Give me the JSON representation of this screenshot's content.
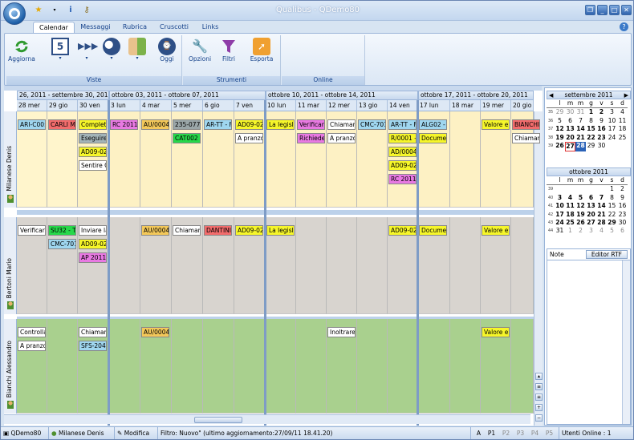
{
  "window": {
    "title": "Qualibus  -  QDemo80"
  },
  "tabs": [
    {
      "label": "Calendar"
    },
    {
      "label": "Messaggi"
    },
    {
      "label": "Rubrica"
    },
    {
      "label": "Cruscotti"
    },
    {
      "label": "Links"
    }
  ],
  "ribbon": {
    "groups": [
      {
        "label": "Viste"
      },
      {
        "label": "Strumenti"
      },
      {
        "label": "Online"
      }
    ],
    "buttons": {
      "aggiorna": "Aggiorna",
      "oggi": "Oggi",
      "opzioni": "Opzioni",
      "filtri": "Filtri",
      "esporta": "Esporta",
      "day_number": "5"
    }
  },
  "calendar": {
    "weeks": [
      {
        "label": "26, 2011 - settembre 30, 2011"
      },
      {
        "label": "ottobre 03, 2011 - ottobre 07, 2011"
      },
      {
        "label": "ottobre 10, 2011 - ottobre 14, 2011"
      },
      {
        "label": "ottobre 17, 2011 - ottobre 20, 2011"
      }
    ],
    "days": [
      "28 mer",
      "29 gio",
      "30 ven",
      "3 lun",
      "4 mar",
      "5 mer",
      "6 gio",
      "7 ven",
      "10 lun",
      "11 mar",
      "12 mer",
      "13 gio",
      "14 ven",
      "17 lun",
      "18 mar",
      "19 mer",
      "20 gio"
    ],
    "resources": [
      {
        "name": "Milanese Denis",
        "color": "#fdf1c4"
      },
      {
        "name": "Bertoni Mario",
        "color": "#d8d4cf"
      },
      {
        "name": "Bianchi Alessandro",
        "color": "#a9d08e"
      }
    ],
    "events": [
      {
        "res": 0,
        "day": 0,
        "row": 0,
        "text": "ARI-C00:",
        "color": "#9fd6ef"
      },
      {
        "res": 0,
        "day": 1,
        "row": 0,
        "text": "CARLI MA",
        "color": "#f26c6c"
      },
      {
        "res": 0,
        "day": 2,
        "row": 0,
        "text": "Completa",
        "color": "#f6f62a"
      },
      {
        "res": 0,
        "day": 2,
        "row": 1,
        "text": "Eseguire",
        "color": "#a3b4b8"
      },
      {
        "res": 0,
        "day": 2,
        "row": 2,
        "text": "AD09-02",
        "color": "#f6f62a"
      },
      {
        "res": 0,
        "day": 2,
        "row": 3,
        "text": "Sentire C",
        "color": "#ffffff"
      },
      {
        "res": 0,
        "day": 3,
        "row": 0,
        "text": "RC 2011",
        "color": "#e879e2"
      },
      {
        "res": 0,
        "day": 4,
        "row": 0,
        "text": "AU/0004",
        "color": "#f3c85a"
      },
      {
        "res": 0,
        "day": 5,
        "row": 0,
        "text": "235-0770",
        "color": "#9aa6a8"
      },
      {
        "res": 0,
        "day": 5,
        "row": 1,
        "text": "CAT002 -",
        "color": "#27d84a"
      },
      {
        "res": 0,
        "day": 6,
        "row": 0,
        "text": "AR-TT - F",
        "color": "#9fd6ef"
      },
      {
        "res": 0,
        "day": 7,
        "row": 0,
        "text": "AD09-02",
        "color": "#f6f62a"
      },
      {
        "res": 0,
        "day": 7,
        "row": 1,
        "text": "A pranzo",
        "color": "#ffffff"
      },
      {
        "res": 0,
        "day": 8,
        "row": 0,
        "text": "La legisla",
        "color": "#f6f62a"
      },
      {
        "res": 0,
        "day": 9,
        "row": 0,
        "text": "Verificare",
        "color": "#e879e2"
      },
      {
        "res": 0,
        "day": 9,
        "row": 1,
        "text": "Richieder",
        "color": "#e879e2"
      },
      {
        "res": 0,
        "day": 10,
        "row": 0,
        "text": "Chiamare",
        "color": "#ffffff"
      },
      {
        "res": 0,
        "day": 10,
        "row": 1,
        "text": "A pranzo",
        "color": "#ffffff"
      },
      {
        "res": 0,
        "day": 11,
        "row": 0,
        "text": "CMC-701",
        "color": "#9fd6ef"
      },
      {
        "res": 0,
        "day": 12,
        "row": 0,
        "text": "AR-TT - F",
        "color": "#9fd6ef"
      },
      {
        "res": 0,
        "day": 12,
        "row": 1,
        "text": "R/0001 -",
        "color": "#f6f62a"
      },
      {
        "res": 0,
        "day": 12,
        "row": 2,
        "text": "AD/0004",
        "color": "#f6f62a"
      },
      {
        "res": 0,
        "day": 12,
        "row": 3,
        "text": "AD09-02",
        "color": "#f6f62a"
      },
      {
        "res": 0,
        "day": 12,
        "row": 4,
        "text": "RC 2011",
        "color": "#e879e2"
      },
      {
        "res": 0,
        "day": 13,
        "row": 0,
        "text": "ALG02 - I",
        "color": "#9fd6ef"
      },
      {
        "res": 0,
        "day": 13,
        "row": 1,
        "text": "Documer",
        "color": "#f6f62a"
      },
      {
        "res": 0,
        "day": 15,
        "row": 0,
        "text": "Valore e",
        "color": "#f6f62a"
      },
      {
        "res": 0,
        "day": 16,
        "row": 0,
        "text": "BIANCHI",
        "color": "#f26c6c"
      },
      {
        "res": 0,
        "day": 16,
        "row": 1,
        "text": "Chiamar",
        "color": "#ffffff"
      },
      {
        "res": 1,
        "day": 0,
        "row": 0,
        "text": "Verificare",
        "color": "#ffffff"
      },
      {
        "res": 1,
        "day": 1,
        "row": 0,
        "text": "SU32 - T",
        "color": "#27d84a"
      },
      {
        "res": 1,
        "day": 1,
        "row": 1,
        "text": "CMC-701",
        "color": "#9fd6ef"
      },
      {
        "res": 1,
        "day": 2,
        "row": 0,
        "text": "Inviare la",
        "color": "#ffffff"
      },
      {
        "res": 1,
        "day": 2,
        "row": 1,
        "text": "AD09-02",
        "color": "#f6f62a"
      },
      {
        "res": 1,
        "day": 2,
        "row": 2,
        "text": "AP 2011",
        "color": "#e879e2"
      },
      {
        "res": 1,
        "day": 4,
        "row": 0,
        "text": "AU/0004",
        "color": "#f3c85a"
      },
      {
        "res": 1,
        "day": 5,
        "row": 0,
        "text": "Chiamare",
        "color": "#ffffff"
      },
      {
        "res": 1,
        "day": 6,
        "row": 0,
        "text": "DANTINI",
        "color": "#f26c6c"
      },
      {
        "res": 1,
        "day": 7,
        "row": 0,
        "text": "AD09-02",
        "color": "#f6f62a"
      },
      {
        "res": 1,
        "day": 8,
        "row": 0,
        "text": "La legisla",
        "color": "#f6f62a"
      },
      {
        "res": 1,
        "day": 12,
        "row": 0,
        "text": "AD09-02",
        "color": "#f6f62a"
      },
      {
        "res": 1,
        "day": 13,
        "row": 0,
        "text": "Documer",
        "color": "#f6f62a"
      },
      {
        "res": 1,
        "day": 15,
        "row": 0,
        "text": "Valore e",
        "color": "#f6f62a"
      },
      {
        "res": 2,
        "day": 0,
        "row": 0,
        "text": "Controlla",
        "color": "#ffffff"
      },
      {
        "res": 2,
        "day": 0,
        "row": 1,
        "text": "A pranzo",
        "color": "#ffffff"
      },
      {
        "res": 2,
        "day": 2,
        "row": 0,
        "text": "Chiamare",
        "color": "#ffffff"
      },
      {
        "res": 2,
        "day": 2,
        "row": 1,
        "text": "SFS-204",
        "color": "#9fd6ef"
      },
      {
        "res": 2,
        "day": 4,
        "row": 0,
        "text": "AU/0004",
        "color": "#f3c85a"
      },
      {
        "res": 2,
        "day": 10,
        "row": 0,
        "text": "Inoltrare",
        "color": "#ffffff"
      },
      {
        "res": 2,
        "day": 15,
        "row": 0,
        "text": "Valore e",
        "color": "#f6f62a"
      }
    ]
  },
  "minical": [
    {
      "title": "settembre 2011",
      "weekdays": [
        "l",
        "m",
        "m",
        "g",
        "v",
        "s",
        "d"
      ],
      "rows": [
        {
          "wk": "35",
          "days": [
            "29",
            "30",
            "31",
            "1",
            "2",
            "3",
            "4"
          ]
        },
        {
          "wk": "36",
          "days": [
            "5",
            "6",
            "7",
            "8",
            "9",
            "10",
            "11"
          ]
        },
        {
          "wk": "37",
          "days": [
            "12",
            "13",
            "14",
            "15",
            "16",
            "17",
            "18"
          ]
        },
        {
          "wk": "38",
          "days": [
            "19",
            "20",
            "21",
            "22",
            "23",
            "24",
            "25"
          ]
        },
        {
          "wk": "39",
          "days": [
            "26",
            "27",
            "28",
            "29",
            "30",
            "",
            ""
          ]
        }
      ]
    },
    {
      "title": "ottobre 2011",
      "weekdays": [
        "l",
        "m",
        "m",
        "g",
        "v",
        "s",
        "d"
      ],
      "rows": [
        {
          "wk": "39",
          "days": [
            "",
            "",
            "",
            "",
            "",
            "1",
            "2"
          ]
        },
        {
          "wk": "40",
          "days": [
            "3",
            "4",
            "5",
            "6",
            "7",
            "8",
            "9"
          ]
        },
        {
          "wk": "41",
          "days": [
            "10",
            "11",
            "12",
            "13",
            "14",
            "15",
            "16"
          ]
        },
        {
          "wk": "42",
          "days": [
            "17",
            "18",
            "19",
            "20",
            "21",
            "22",
            "23"
          ]
        },
        {
          "wk": "43",
          "days": [
            "24",
            "25",
            "26",
            "27",
            "28",
            "29",
            "30"
          ]
        },
        {
          "wk": "44",
          "days": [
            "31",
            "1",
            "2",
            "3",
            "4",
            "5",
            "6"
          ]
        }
      ]
    }
  ],
  "notes": {
    "label": "Note",
    "rtf_button": "Editor RTF"
  },
  "status": {
    "db": "QDemo80",
    "user": "Milanese Denis",
    "mode": "Modifica",
    "filter": "Filtro: Nuovo\" (ultimo aggiornamento:27/09/11 18.41.20)",
    "pages": [
      "A",
      "P1",
      "P2",
      "P3",
      "P4",
      "P5"
    ],
    "online": "Utenti Online : 1"
  }
}
